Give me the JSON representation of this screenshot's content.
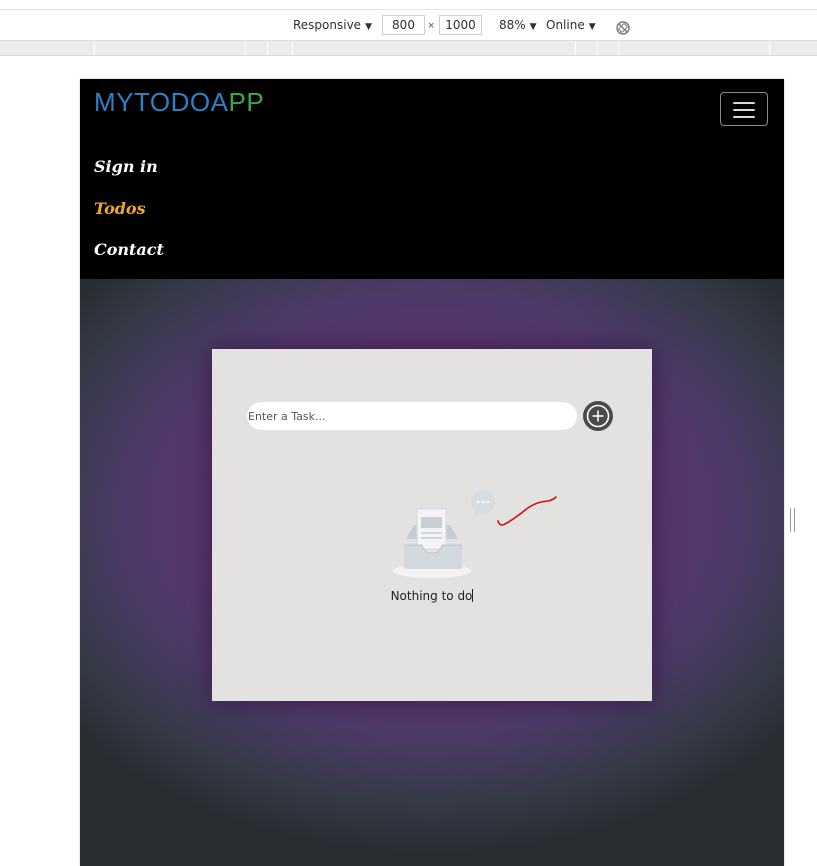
{
  "devtools": {
    "device_mode": "Responsive",
    "width_value": "800",
    "height_value": "1000",
    "zoom": "88%",
    "network": "Online",
    "rotate_icon": "rotate-disabled-icon",
    "times_glyph": "×",
    "caret": "▼"
  },
  "navbar": {
    "brand_part1": "MYTODOA",
    "brand_part2": "PP",
    "brand_colors": [
      "#2f7fc4",
      "#3aa64a"
    ],
    "links": [
      {
        "label": "Sign in",
        "active": false
      },
      {
        "label": "Todos",
        "active": true
      },
      {
        "label": "Contact",
        "active": false
      }
    ],
    "toggler_icon": "hamburger-menu-icon",
    "active_color": "#f0a82a"
  },
  "todo": {
    "input_placeholder": "Enter a Task...",
    "input_value": "",
    "add_icon": "plus-circle-icon",
    "empty_text": "Nothing to do",
    "empty_icon": "empty-inbox-icon"
  }
}
